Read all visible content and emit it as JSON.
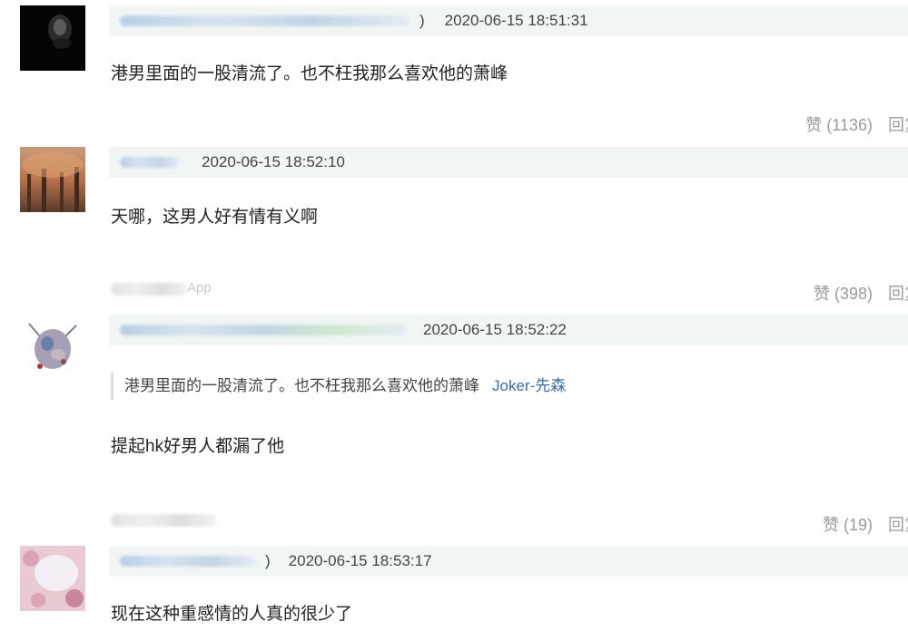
{
  "comments": [
    {
      "timestamp": "2020-06-15 18:51:31",
      "name_suffix": ")",
      "text": "港男里面的一股清流了。也不枉我那么喜欢他的萧峰",
      "likes_label": "赞 (1136)",
      "reply_label": "回复"
    },
    {
      "timestamp": "2020-06-15 18:52:10",
      "text": "天哪，这男人好有情有义啊",
      "device_tail": "App",
      "likes_label": "赞 (398)",
      "reply_label": "回复"
    },
    {
      "timestamp": "2020-06-15 18:52:22",
      "quote_text": "港男里面的一股清流了。也不枉我那么喜欢他的萧峰",
      "quote_author": "Joker-先森",
      "text": "提起hk好男人都漏了他",
      "likes_label": "赞 (19)",
      "reply_label": "回复"
    },
    {
      "timestamp": "2020-06-15 18:53:17",
      "name_suffix": ")",
      "text": "现在这种重感情的人真的很少了"
    }
  ]
}
